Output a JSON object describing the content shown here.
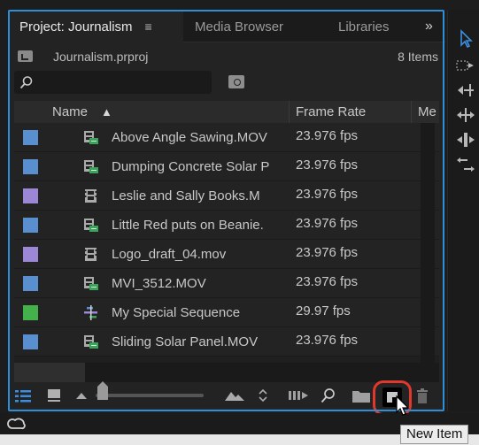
{
  "tabs": {
    "project": "Project: Journalism",
    "project_menu_glyph": "≡",
    "media_browser": "Media Browser",
    "libraries": "Libraries",
    "overflow": "»"
  },
  "project": {
    "file": "Journalism.prproj",
    "item_count": "8 Items"
  },
  "search": {
    "placeholder": ""
  },
  "table": {
    "columns": {
      "name": "Name",
      "sort_arrow": "▲",
      "frame_rate": "Frame Rate",
      "media": "Me"
    },
    "rows": [
      {
        "name": "Above Angle Sawing.MOV",
        "rate": "23.976 fps",
        "label_color": "#5a8fcf",
        "icon": "clip-av-icon"
      },
      {
        "name": "Dumping Concrete Solar P",
        "rate": "23.976 fps",
        "label_color": "#5a8fcf",
        "icon": "clip-av-icon"
      },
      {
        "name": "Leslie and Sally  Books.M",
        "rate": "23.976 fps",
        "label_color": "#9b87d6",
        "icon": "clip-video-icon"
      },
      {
        "name": "Little Red puts on Beanie.",
        "rate": "23.976 fps",
        "label_color": "#5a8fcf",
        "icon": "clip-av-icon"
      },
      {
        "name": "Logo_draft_04.mov",
        "rate": "23.976 fps",
        "label_color": "#9b87d6",
        "icon": "clip-video-icon"
      },
      {
        "name": "MVI_3512.MOV",
        "rate": "23.976 fps",
        "label_color": "#5a8fcf",
        "icon": "clip-av-icon"
      },
      {
        "name": "My Special Sequence",
        "rate": "29.97 fps",
        "label_color": "#44b24a",
        "icon": "sequence-icon"
      },
      {
        "name": "Sliding Solar Panel.MOV",
        "rate": "23.976 fps",
        "label_color": "#5a8fcf",
        "icon": "clip-av-icon"
      }
    ]
  },
  "tooltip": {
    "text": "New Item"
  },
  "colors": {
    "accent": "#2e8fd8",
    "highlight": "#e0382c"
  }
}
